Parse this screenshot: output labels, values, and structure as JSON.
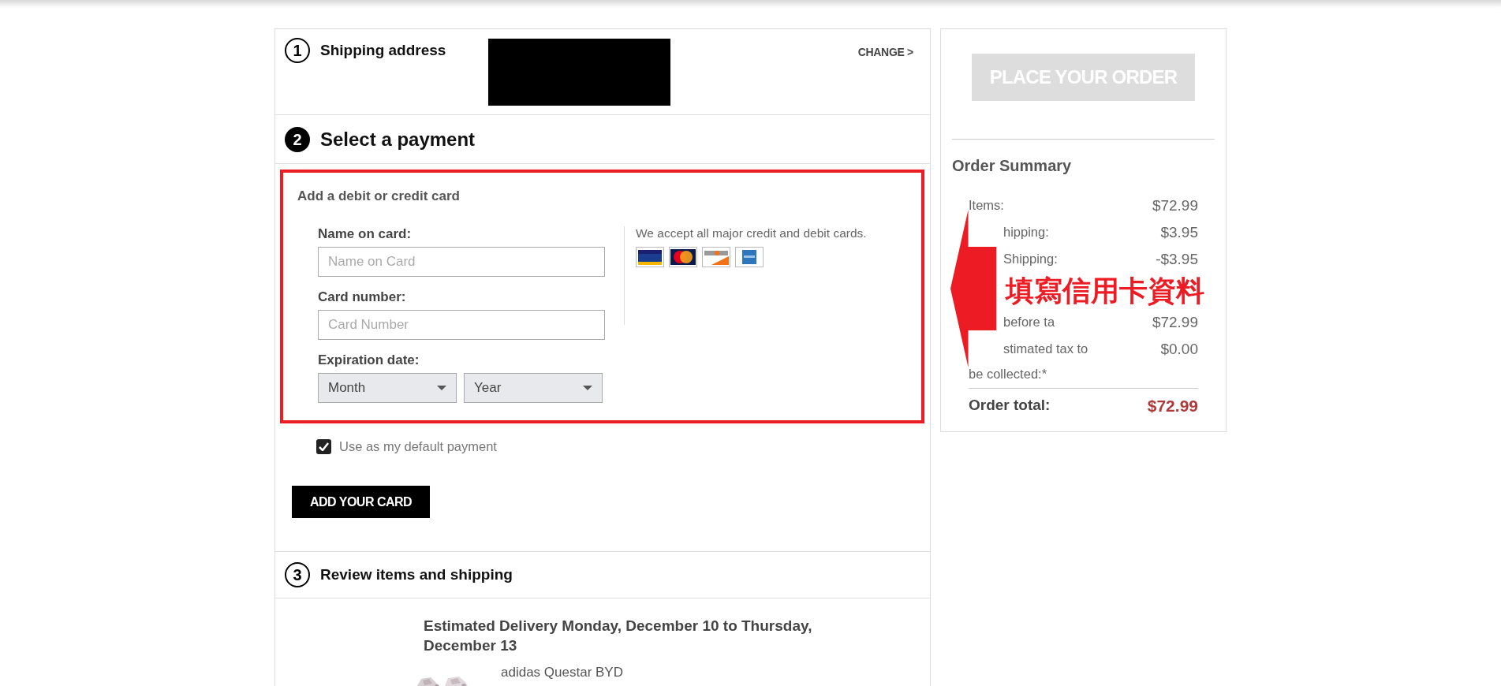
{
  "steps": [
    {
      "number": "1",
      "title": "Shipping address",
      "active": false,
      "action": "CHANGE >"
    },
    {
      "number": "2",
      "title": "Select a payment",
      "active": true
    },
    {
      "number": "3",
      "title": "Review items and shipping",
      "active": false
    }
  ],
  "card_form": {
    "heading": "Add a debit or credit card",
    "fields": [
      {
        "label": "Name on card:",
        "placeholder": "Name on Card"
      },
      {
        "label": "Card number:",
        "placeholder": "Card Number"
      }
    ],
    "expiration": {
      "label": "Expiration date:",
      "month": "Month",
      "year": "Year"
    },
    "accept_note": "We accept all major credit and debit cards.",
    "default_payment": {
      "label": "Use as my default payment",
      "checked": true
    },
    "submit": "ADD YOUR CARD"
  },
  "delivery": {
    "estimate": "Estimated Delivery Monday, December 10 to Thursday, December 13",
    "item": {
      "kind": "picture",
      "name": "adidas Questar BYD"
    }
  },
  "place_order": {
    "label": "PLACE YOUR ORDER",
    "disabled": true
  },
  "summary": {
    "title": "Order Summary",
    "rows": [
      {
        "label": "Items:",
        "value": "$72.99",
        "covered": false
      },
      {
        "label": "hipping:",
        "value": "$3.95",
        "covered": true
      },
      {
        "label": "Shipping:",
        "value": "-$3.95",
        "covered": true
      },
      {
        "label": "before ta",
        "value": "$72.99",
        "covered": true
      },
      {
        "label": "stimated tax to be collected:*",
        "value": "$0.00",
        "covered": true
      }
    ],
    "total_label": "Order total:",
    "total_value": "$72.99"
  },
  "annotation": {
    "text": "填寫信用卡資料"
  }
}
